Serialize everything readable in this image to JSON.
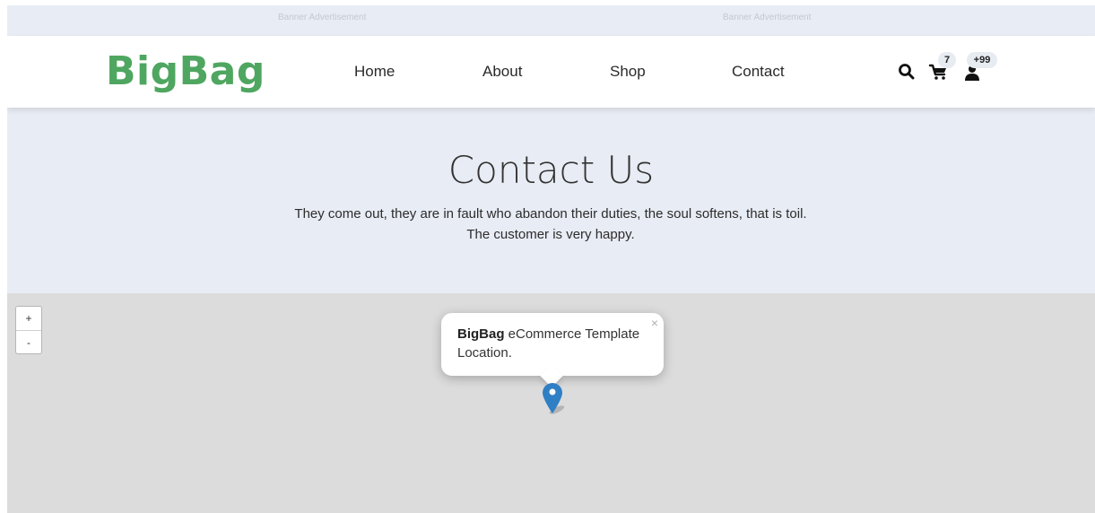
{
  "banner": {
    "left_text": "Banner Advertisement",
    "right_text": "Banner Advertisement"
  },
  "header": {
    "logo": "BigBag",
    "nav": {
      "home": "Home",
      "about": "About",
      "shop": "Shop",
      "contact": "Contact"
    },
    "icons": {
      "search": "search-icon",
      "cart": "cart-icon",
      "user": "user-icon"
    },
    "cart_count": "7",
    "user_count": "+99"
  },
  "hero": {
    "title": "Contact Us",
    "text": "They come out, they are in fault who abandon their duties, the soul softens, that is toil. The customer is very happy."
  },
  "map": {
    "zoom_in": "+",
    "zoom_out": "-",
    "popup": {
      "close": "×",
      "bold_text": "BigBag",
      "text": " eCommerce Template Location."
    }
  },
  "colors": {
    "brand": "#4fa660",
    "banner_bg": "#e8ecf4",
    "map_bg": "#dcdcdc",
    "marker": "#2f7fc4"
  }
}
